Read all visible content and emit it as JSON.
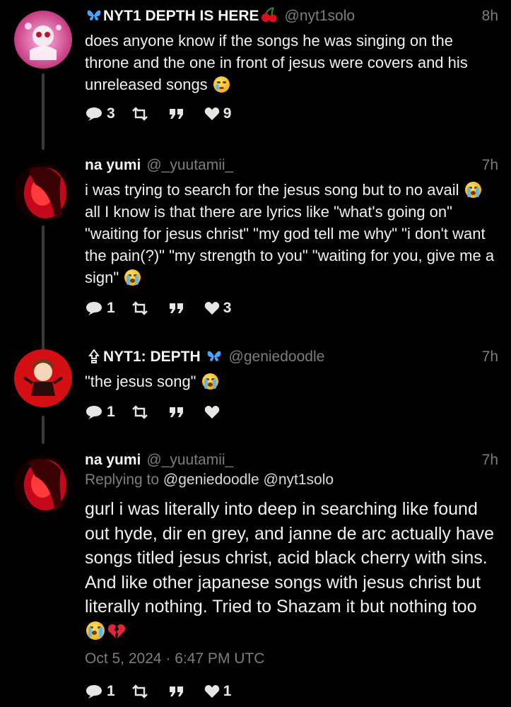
{
  "tweets": [
    {
      "display_name": "NYT1 DEPTH IS HERE",
      "handle": "@nyt1solo",
      "time": "8h",
      "text_before": "does anyone know if the songs he was singing on the throne and the one in front of jesus were covers and his unreleased songs",
      "actions": {
        "replies": "3",
        "retweets": "",
        "quotes": "",
        "likes": "9"
      }
    },
    {
      "display_name": "na yumi",
      "handle": "@_yuutamii_",
      "time": "7h",
      "text_before": "i was trying to search for the jesus song but to no avail",
      "text_after": "all I know is that there are lyrics like \"what's going on\" \"waiting for jesus christ\" \"my god tell me why\" \"i don't want the pain(?)\" \"my strength to you\" \"waiting for you, give me a sign\"",
      "actions": {
        "replies": "1",
        "retweets": "",
        "quotes": "",
        "likes": "3"
      }
    },
    {
      "display_name": "NYT1: DEPTH",
      "handle": "@geniedoodle",
      "time": "7h",
      "text_before": "\"the jesus song\"",
      "actions": {
        "replies": "1",
        "retweets": "",
        "quotes": "",
        "likes": ""
      }
    },
    {
      "display_name": "na yumi",
      "handle": "@_yuutamii_",
      "time": "7h",
      "replying_label": "Replying to",
      "replying_to": "@geniedoodle @nyt1solo",
      "text_before": "gurl i was literally into deep in searching like found out hyde, dir en grey, and janne de arc actually have songs titled jesus christ, acid black cherry with sins. And like other japanese songs with jesus christ but literally nothing. Tried to Shazam it but nothing too",
      "date": "Oct 5, 2024 · 6:47 PM UTC",
      "actions": {
        "replies": "1",
        "retweets": "",
        "quotes": "",
        "likes": "1"
      }
    }
  ],
  "icons": [
    "reply-icon",
    "retweet-icon",
    "quote-icon",
    "heart-icon",
    "butterfly-icon",
    "cherry-icon",
    "sparkle-icon",
    "crying-emoji",
    "sad-tear-emoji",
    "broken-heart-emoji"
  ],
  "colors": {
    "background": "#000000",
    "text": "#f2f2f2",
    "muted": "#7d7d7d",
    "avatar_red": "#d11a1a",
    "butterfly": "#4aa3ff"
  }
}
